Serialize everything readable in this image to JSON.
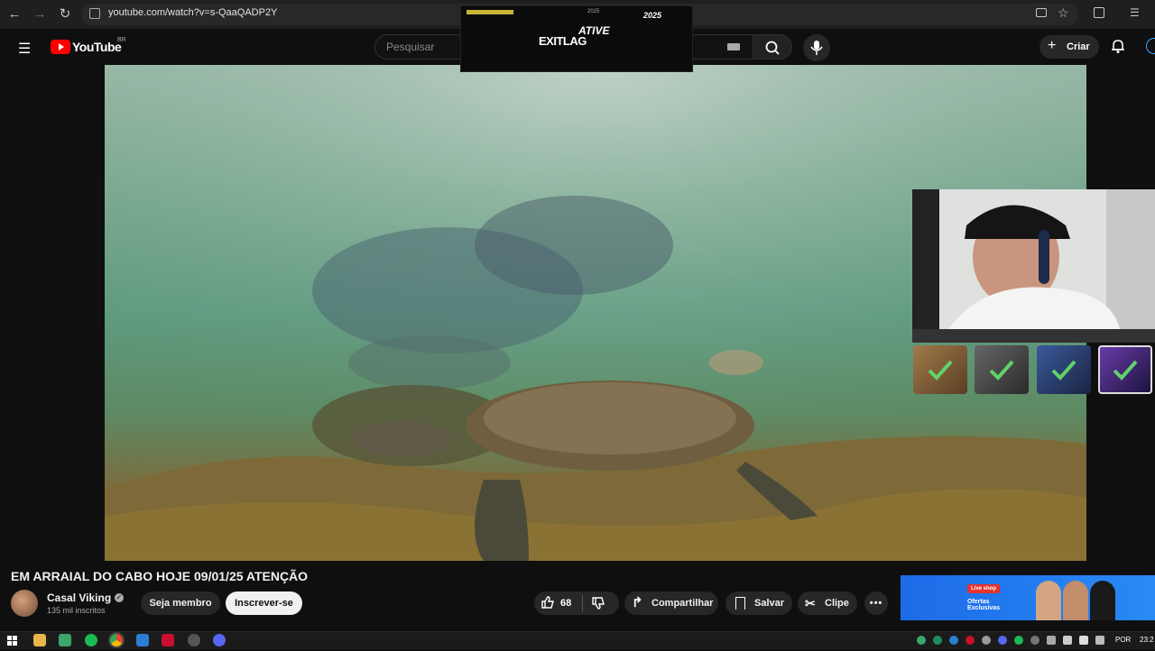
{
  "browser": {
    "url": "youtube.com/watch?v=s-QaaQADP2Y"
  },
  "youtube": {
    "logo_text": "YouTube",
    "country_code": "BR",
    "search_placeholder": "Pesquisar",
    "create_label": "Criar"
  },
  "ad_overlay": {
    "headline": "ATIVE",
    "brand": "EXITLAG",
    "tag": "2025"
  },
  "video": {
    "title": "EM ARRAIAL DO CABO HOJE 09/01/25 ATENÇÃO",
    "channel_name": "Casal Viking",
    "subscribers": "135 mil inscritos",
    "join_label": "Seja membro",
    "subscribe_label": "Inscrever-se",
    "likes": "68",
    "share_label": "Compartilhar",
    "save_label": "Salvar",
    "clip_label": "Clipe"
  },
  "sidebar_ad": {
    "tag": "Live shop",
    "text": "Ofertas Exclusivas"
  },
  "taskbar": {
    "language": "POR",
    "time": "23:2"
  },
  "colors": {
    "youtube_red": "#ff0000",
    "subscribe_bg": "#f1f1f1",
    "accent_blue": "#3ea6ff"
  }
}
